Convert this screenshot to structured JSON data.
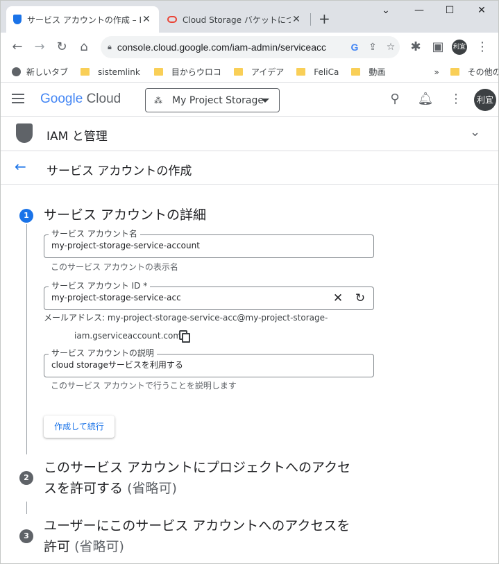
{
  "browser": {
    "tabs": [
      {
        "title": "サービス アカウントの作成 – IAM"
      },
      {
        "title": "Cloud Storage バケットについて"
      }
    ],
    "new_tab": "+",
    "url": "console.cloud.google.com/iam-admin/serviceacc",
    "profile_initials": "利宜",
    "bookmarks": [
      {
        "label": "新しいタブ"
      },
      {
        "label": "sistemlink"
      },
      {
        "label": "目からウロコ"
      },
      {
        "label": "アイデア"
      },
      {
        "label": "FeliCa"
      },
      {
        "label": "動画"
      }
    ],
    "bookmarks_overflow": "»",
    "other_bookmarks": "その他のブックマーク"
  },
  "header": {
    "logo_google": "Google",
    "logo_cloud": "Cloud",
    "project": "My Project Storage",
    "user_initials": "利宜"
  },
  "section": {
    "title": "IAM と管理"
  },
  "page": {
    "title": "サービス アカウントの作成"
  },
  "steps": [
    {
      "number": "1",
      "title": "サービス アカウントの詳細"
    },
    {
      "number": "2",
      "title_line1": "このサービス アカウントにプロジェクトへのアクセ",
      "title_line2": "スを許可する",
      "optional": "(省略可)"
    },
    {
      "number": "3",
      "title_line1": "ユーザーにこのサービス アカウントへのアクセスを",
      "title_line2": "許可",
      "optional": "(省略可)"
    }
  ],
  "form": {
    "name": {
      "label": "サービス アカウント名",
      "value": "my-project-storage-service-account",
      "hint": "このサービス アカウントの表示名"
    },
    "id": {
      "label": "サービス アカウント ID *",
      "value": "my-project-storage-service-acc"
    },
    "email_line1": "メールアドレス: my-project-storage-service-acc@my-project-storage-",
    "email_line2": "iam.gserviceaccount.com",
    "description": {
      "label": "サービス アカウントの説明",
      "value": "cloud storageサービスを利用する",
      "hint": "このサービス アカウントで行うことを説明します"
    },
    "submit_label": "作成して続行"
  },
  "colors": {
    "accent": "#1a73e8",
    "text": "#202124",
    "muted": "#5f6368"
  }
}
